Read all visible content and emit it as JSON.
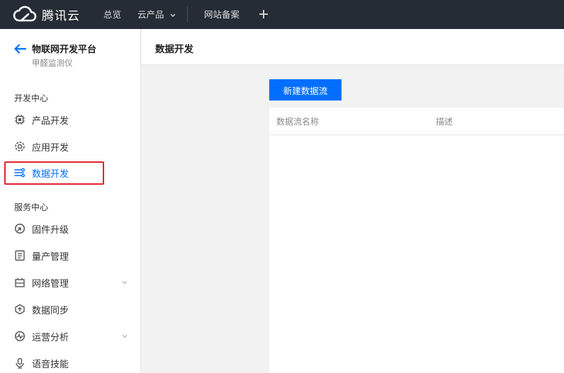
{
  "topbar": {
    "brand": "腾讯云",
    "nav": [
      {
        "label": "总览"
      },
      {
        "label": "云产品"
      },
      {
        "label": "网站备案"
      }
    ],
    "icons": {
      "logo": "tencent-cloud-logo",
      "dropdown": "chevron-down-icon",
      "add": "plus-icon"
    }
  },
  "sidebar": {
    "back_icon": "arrow-left-icon",
    "platform_title": "物联网开发平台",
    "device_name": "甲醛监测仪",
    "sections": [
      {
        "title": "开发中心",
        "items": [
          {
            "label": "产品开发",
            "icon": "chip-icon"
          },
          {
            "label": "应用开发",
            "icon": "gear-ring-icon"
          },
          {
            "label": "数据开发",
            "icon": "data-flow-icon",
            "active": true
          }
        ]
      },
      {
        "title": "服务中心",
        "items": [
          {
            "label": "固件升级",
            "icon": "firmware-icon"
          },
          {
            "label": "量产管理",
            "icon": "document-list-icon"
          },
          {
            "label": "网络管理",
            "icon": "network-icon",
            "expandable": true
          },
          {
            "label": "数据同步",
            "icon": "sync-icon"
          },
          {
            "label": "运营分析",
            "icon": "analytics-icon",
            "expandable": true
          },
          {
            "label": "语音技能",
            "icon": "voice-icon"
          }
        ]
      }
    ],
    "accent_color": "#006eff",
    "highlight_color": "#e3232f"
  },
  "main": {
    "title": "数据开发",
    "create_button": "新建数据流",
    "table": {
      "columns": [
        "数据流名称",
        "描述"
      ]
    }
  }
}
